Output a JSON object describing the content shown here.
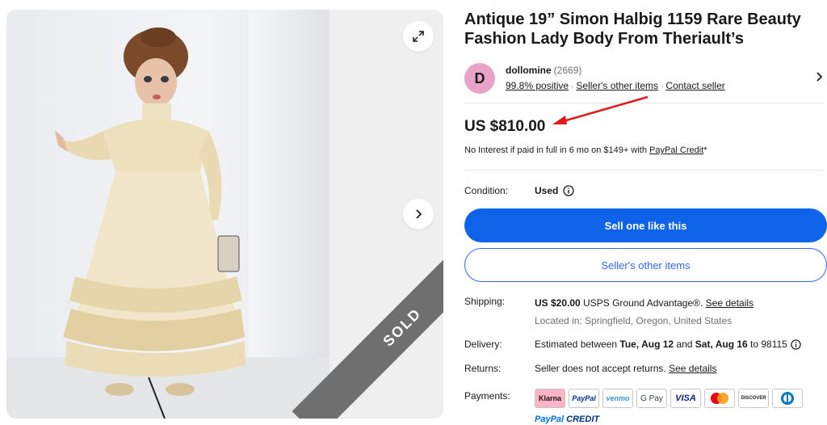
{
  "listing": {
    "title": "Antique 19” Simon Halbig 1159 Rare Beauty Fashion Lady Body From Theriault’s",
    "sold_label": "SOLD"
  },
  "seller": {
    "initial": "D",
    "name": "dollomine",
    "score": "(2669)",
    "positive": "99.8% positive",
    "other_items_link": "Seller's other items",
    "contact_link": "Contact seller"
  },
  "price": {
    "amount": "US $810.00",
    "credit_text": "No Interest if paid in full in 6 mo on $149+ with ",
    "credit_link": "PayPal Credit",
    "credit_suffix": "*"
  },
  "condition": {
    "label": "Condition:",
    "value": "Used"
  },
  "buttons": {
    "sell": "Sell one like this",
    "other_items": "Seller's other items"
  },
  "shipping": {
    "label": "Shipping:",
    "cost": "US $20.00",
    "service": " USPS Ground Advantage®. ",
    "details_link": "See details",
    "location": "Located in: Springfield, Oregon, United States"
  },
  "delivery": {
    "label": "Delivery:",
    "prefix": "Estimated between ",
    "start": "Tue, Aug 12",
    "mid": " and ",
    "end": "Sat, Aug 16",
    "suffix": " to 98115"
  },
  "returns": {
    "label": "Returns:",
    "text": "Seller does not accept returns. ",
    "details_link": "See details"
  },
  "payments": {
    "label": "Payments:",
    "methods": [
      "Klarna",
      "PayPal",
      "venmo",
      "G Pay",
      "VISA",
      "",
      "DISCOVER",
      ""
    ],
    "paypal_credit_a": "PayPal",
    "paypal_credit_b": " CREDIT"
  },
  "colors": {
    "primary_button": "#0f63e8",
    "secondary_border": "#3665f3",
    "avatar": "#e9a3c9",
    "sold_ribbon": "#6f6f6f",
    "annotation_arrow": "#e0191b"
  }
}
